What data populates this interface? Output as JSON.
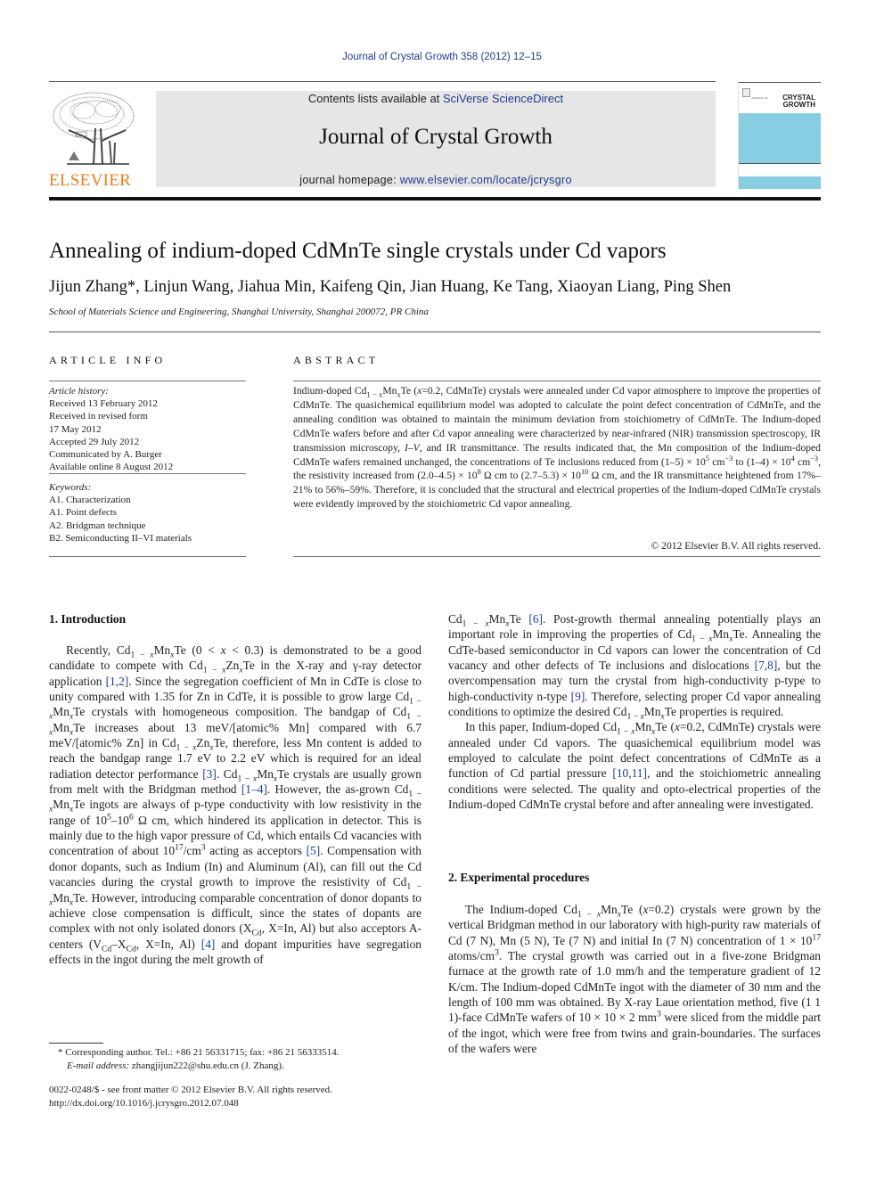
{
  "running_head": "Journal of Crystal Growth 358 (2012) 12–15",
  "header": {
    "publisher_logo_text": "ELSEVIER",
    "contents_prefix": "Contents lists available at ",
    "contents_link": "SciVerse ScienceDirect",
    "journal_title": "Journal of Crystal Growth",
    "homepage_prefix": "journal homepage: ",
    "homepage_link": "www.elsevier.com/locate/jcrysgro",
    "cover_small_text": "JOURNAL OF",
    "cover_title_line1": "CRYSTAL",
    "cover_title_line2": "GROWTH",
    "colors": {
      "link": "#1d3c8f",
      "elsevier_orange": "#f07d1a",
      "banner_gray": "#e6e6e6",
      "cover_blue": "#86cfe3"
    }
  },
  "article": {
    "title": "Annealing of indium-doped CdMnTe single crystals under Cd vapors",
    "authors": "Jijun Zhang*, Linjun Wang, Jiahua Min, Kaifeng Qin, Jian Huang, Ke Tang, Xiaoyan Liang, Ping Shen",
    "affiliation": "School of Materials Science and Engineering, Shanghai University, Shanghai 200072, PR China"
  },
  "article_info": {
    "heading": "ARTICLE INFO",
    "history_label": "Article history:",
    "history": [
      "Received 13 February 2012",
      "Received in revised form",
      "17 May 2012",
      "Accepted 29 July 2012",
      "Communicated by A. Burger",
      "Available online 8 August 2012"
    ],
    "keywords_label": "Keywords:",
    "keywords": [
      "A1. Characterization",
      "A1. Point defects",
      "A2. Bridgman technique",
      "B2. Semiconducting II–VI materials"
    ]
  },
  "abstract": {
    "heading": "ABSTRACT",
    "p1_a": "Indium-doped Cd",
    "p1_sub1": "1 − x",
    "p1_b": "Mn",
    "p1_sub2": "x",
    "p1_c": "Te (",
    "p1_x": "x",
    "p1_d": "=0.2, CdMnTe) crystals were annealed under Cd vapor atmosphere to improve the properties of CdMnTe. The quasichemical equilibrium model was adopted to calculate the point defect concentration of CdMnTe, and the annealing condition was obtained to maintain the minimum deviation from stoichiometry of CdMnTe. The Indium-doped CdMnTe wafers before and after Cd vapor annealing were characterized by near-infrared (NIR) transmission spectroscopy, IR transmission microscopy, ",
    "p1_iv": "I–V",
    "p1_e": ", and IR transmittance. The results indicated that, the Mn composition of the Indium-doped CdMnTe wafers remained unchanged, the concentrations of Te inclusions reduced from (1–5) × 10",
    "p1_sup1": "5",
    "p1_f": " cm",
    "p1_sup2": "−3",
    "p1_g": " to (1–4) × 10",
    "p1_sup3": "4",
    "p1_h": " cm",
    "p1_sup4": "−3",
    "p1_i": ", the resistivity increased from (2.0–4.5) × 10",
    "p1_sup5": "8",
    "p1_j": " Ω cm to (2.7–5.3) × 10",
    "p1_sup6": "10",
    "p1_k": " Ω cm, and the IR transmittance heightened from 17%–21% to 56%–59%. Therefore, it is concluded that the structural and electrical properties of the Indium-doped CdMnTe crystals were evidently improved by the stoichiometric Cd vapor annealing.",
    "copyright": "© 2012 Elsevier B.V. All rights reserved."
  },
  "sections": {
    "intro_heading": "1.  Introduction",
    "exp_heading": "2.  Experimental procedures"
  },
  "footnote": {
    "corresponding": "* Corresponding author. Tel.: +86 21 56331715; fax: +86 21 56333514.",
    "email_label": "E-mail address: ",
    "email": "zhangjijun222@shu.edu.cn",
    "email_suffix": " (J. Zhang).",
    "issn": "0022-0248/$ - see front matter © 2012 Elsevier B.V. All rights reserved.",
    "doi": "http://dx.doi.org/10.1016/j.jcrysgro.2012.07.048"
  },
  "refs": {
    "r12": "[1,2]",
    "r3": "[3]",
    "r14": "[1–4]",
    "r5": "[5]",
    "r4": "[4]",
    "r6": "[6]",
    "r78": "[7,8]",
    "r9": "[9]",
    "r1011": "[10,11]"
  }
}
